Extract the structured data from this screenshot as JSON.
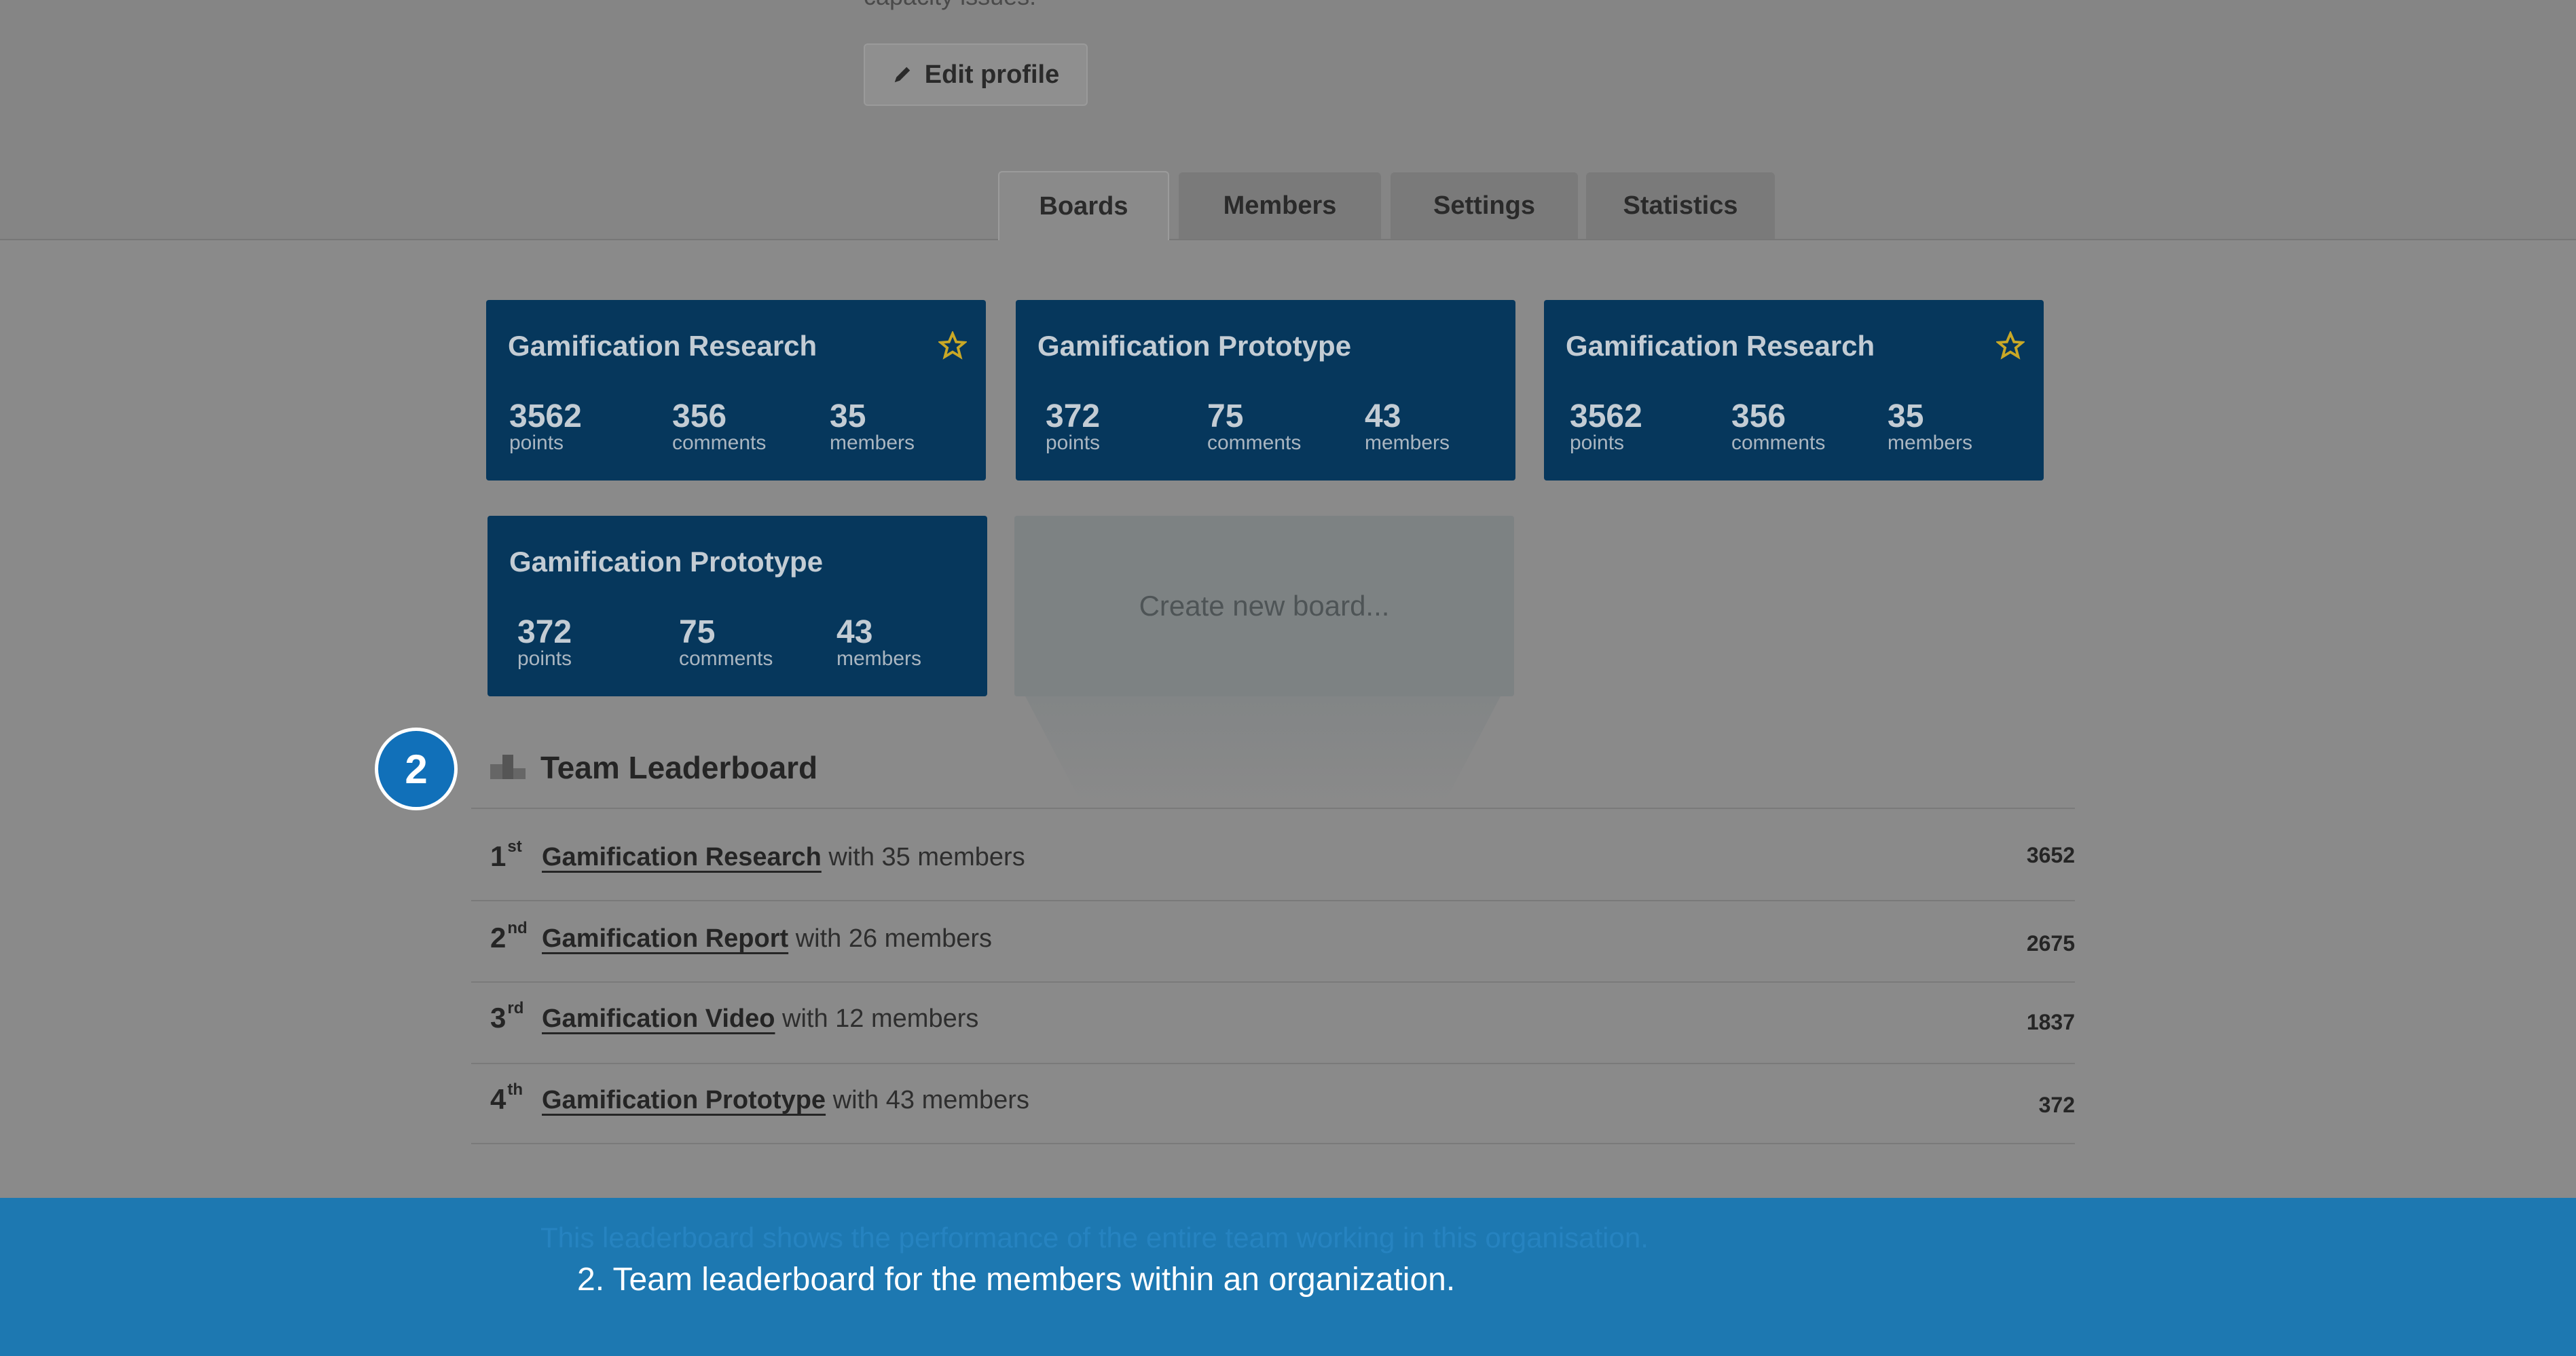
{
  "profile": {
    "caption": "capacity issues.",
    "edit_button_label": "Edit profile",
    "edit_icon": "pencil-icon"
  },
  "tabs": [
    {
      "label": "Boards",
      "active": true
    },
    {
      "label": "Members",
      "active": false
    },
    {
      "label": "Settings",
      "active": false
    },
    {
      "label": "Statistics",
      "active": false
    }
  ],
  "boards": [
    {
      "title": "Gamification Research",
      "starred": true,
      "points": "3562",
      "points_label": "points",
      "comments": "356",
      "comments_label": "comments",
      "members": "35",
      "members_label": "members"
    },
    {
      "title": "Gamification Prototype",
      "starred": false,
      "points": "372",
      "points_label": "points",
      "comments": "75",
      "comments_label": "comments",
      "members": "43",
      "members_label": "members"
    },
    {
      "title": "Gamification Research",
      "starred": true,
      "points": "3562",
      "points_label": "points",
      "comments": "356",
      "comments_label": "comments",
      "members": "35",
      "members_label": "members"
    },
    {
      "title": "Gamification Prototype",
      "starred": false,
      "points": "372",
      "points_label": "points",
      "comments": "75",
      "comments_label": "comments",
      "members": "43",
      "members_label": "members"
    }
  ],
  "create_board_label": "Create new board...",
  "step_badge": "2",
  "leaderboard": {
    "title": "Team Leaderboard",
    "icon": "podium-icon",
    "entries": [
      {
        "rank": "1",
        "suffix": "st",
        "team": "Gamification Research",
        "detail": " with 35 members",
        "score": "3652"
      },
      {
        "rank": "2",
        "suffix": "nd",
        "team": "Gamification Report",
        "detail": " with 26 members",
        "score": "2675"
      },
      {
        "rank": "3",
        "suffix": "rd",
        "team": "Gamification Video",
        "detail": " with 12 members",
        "score": "1837"
      },
      {
        "rank": "4",
        "suffix": "th",
        "team": "Gamification Prototype",
        "detail": " with 43 members",
        "score": "372"
      }
    ]
  },
  "banner": {
    "faint_text": "This leaderboard shows the performance of the entire team working in this organisation.",
    "caption": "2. Team leaderboard for the members within an organization."
  },
  "colors": {
    "card": "#06375c",
    "star": "#c9a826",
    "banner": "#1d78b1",
    "badge": "#1170b9"
  }
}
